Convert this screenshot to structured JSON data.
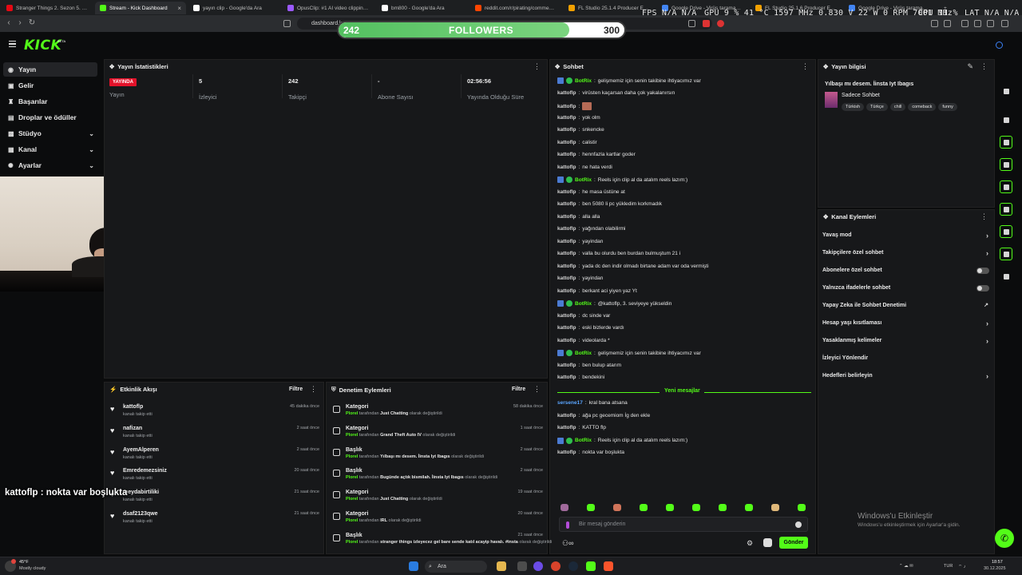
{
  "browser": {
    "tabs": [
      {
        "label": "Stranger Things 2. Sezon 5. Bölüm",
        "color": "#e50914"
      },
      {
        "label": "Stream - Kick Dashboard",
        "color": "#53fc18"
      },
      {
        "label": "yayın clip - Google'da Ara",
        "color": "#ffffff"
      },
      {
        "label": "OpusClip: #1 AI video clipping and",
        "color": "#9b59ff"
      },
      {
        "label": "bm800 - Google'da Ara",
        "color": "#ffffff"
      },
      {
        "label": "reddit.com/r/pirating/comments/",
        "color": "#ff4500"
      },
      {
        "label": "FL Studio 25.1.4 Producer Edition Y",
        "color": "#f2a100"
      },
      {
        "label": "Google Drive - Virüs taraması uya",
        "color": "#4285f4"
      },
      {
        "label": "FL Studio 25.1.6 Producer Edition",
        "color": "#f2a100"
      },
      {
        "label": "Google Drive - Virüs taraması uya",
        "color": "#4285f4"
      }
    ],
    "url": "dashboard.k"
  },
  "hud": {
    "fps": "FPS  N/A  N/A",
    "gpu": "GPU  9 %  41 °C  1597 MHz  0.830 V  22 W  0 RPM  7001 MHz",
    "cpu": "CPU  11 %",
    "lat": "LAT  N/A  N/A"
  },
  "goal": {
    "current": "242",
    "label": "FOLLOWERS",
    "target": "300",
    "progress": 0.8067
  },
  "brand": {
    "logo": "KICK",
    "beta": "BETA"
  },
  "sidebar": {
    "items": [
      {
        "label": "Yayın",
        "icon": "broadcast-icon"
      },
      {
        "label": "Gelir",
        "icon": "revenue-icon"
      },
      {
        "label": "Başarılar",
        "icon": "trophy-icon"
      },
      {
        "label": "Droplar ve ödüller",
        "icon": "gift-icon"
      },
      {
        "label": "Stüdyo",
        "icon": "studio-icon"
      },
      {
        "label": "Kanal",
        "icon": "channel-icon"
      },
      {
        "label": "Ayarlar",
        "icon": "settings-icon"
      }
    ]
  },
  "stats": {
    "title": "Yayın İstatistikleri",
    "live_badge": "YAYINDA",
    "items": [
      {
        "value": "5",
        "label": "İzleyici"
      },
      {
        "value": "242",
        "label": "Takipçi"
      },
      {
        "value": "-",
        "label": "Abone Sayısı"
      },
      {
        "value": "02:56:56",
        "label": "Yayında Olduğu Süre"
      }
    ],
    "stream_label": "Yayın"
  },
  "chat": {
    "title": "Sohbet",
    "messages": [
      {
        "user": "BotRix",
        "bot": true,
        "text": "gelişmemiz için senin takibine ihtiyacımız var"
      },
      {
        "user": "kattoflp",
        "text": "virüsten kaçarsan daha çok yakalanırsın"
      },
      {
        "user": "kattoflp",
        "text": "",
        "emote": true
      },
      {
        "user": "kattoflp",
        "text": "yok olm"
      },
      {
        "user": "kattoflp",
        "text": "snkencke"
      },
      {
        "user": "kattoflp",
        "text": "calistir"
      },
      {
        "user": "kattoflp",
        "text": "hennfazla kartlar goder"
      },
      {
        "user": "kattoflp",
        "text": "ne hata verdi"
      },
      {
        "user": "BotRix",
        "bot": true,
        "text": "Reels için clip al da atalım reels lazım:)"
      },
      {
        "user": "kattoflp",
        "text": "he masa üstüne at"
      },
      {
        "user": "kattoflp",
        "text": "ben 5080 li pc yükledim korkmadık"
      },
      {
        "user": "kattoflp",
        "text": "alla alla"
      },
      {
        "user": "kattoflp",
        "text": "yağından olabilirmi"
      },
      {
        "user": "kattoflp",
        "text": "yayindan"
      },
      {
        "user": "kattoflp",
        "text": "valla bu olurdu ben burdan bulmuştum 21 i"
      },
      {
        "user": "kattoflp",
        "text": "yada dc den indir olmadı birtane adam var oda vermişti"
      },
      {
        "user": "kattoflp",
        "text": "yayindan"
      },
      {
        "user": "kattoflp",
        "text": "berkant aci yiyen yaz Yt"
      },
      {
        "user": "BotRix",
        "bot": true,
        "text": "@kattoflp, 3. seviyeye yükseldin"
      },
      {
        "user": "kattoflp",
        "text": "dc sinde var"
      },
      {
        "user": "kattoflp",
        "text": "eski bizlerde vardı"
      },
      {
        "user": "kattoflp",
        "text": "videolarda *"
      },
      {
        "user": "BotRix",
        "bot": true,
        "text": "gelişmemiz için senin takibine ihtiyacımız var"
      },
      {
        "user": "kattoflp",
        "text": "ben bulup atarım"
      },
      {
        "user": "kattoflp",
        "text": "bendekini"
      }
    ],
    "new_messages_label": "Yeni mesajlar",
    "new_messages": [
      {
        "user": "sersene17",
        "color": "#5aa5ff",
        "text": "kral bana atsana"
      },
      {
        "user": "kattoflp",
        "text": "ağa pc gecemiom İg den ekle"
      },
      {
        "user": "kattoflp",
        "text": "KATTO flp"
      },
      {
        "user": "BotRix",
        "bot": true,
        "text": "Reels için clip al da atalım reels lazım:)"
      },
      {
        "user": "kattoflp",
        "text": "nokta var boşlukta"
      }
    ],
    "input_placeholder": "Bir mesaj gönderin",
    "send_label": "Gönder"
  },
  "stream_info": {
    "title": "Yayın bilgisi",
    "stream_title": "Yılbaşı mı desem. İinsta Iyt Ibagıs",
    "category": "Sadece Sohbet",
    "tags": [
      "Türkish",
      "Türkçe",
      "chill",
      "comeback",
      "funny"
    ]
  },
  "channel_actions": {
    "title": "Kanal Eylemleri",
    "items": [
      {
        "label": "Yavaş mod",
        "type": "arrow"
      },
      {
        "label": "Takipçilere özel sohbet",
        "type": "arrow"
      },
      {
        "label": "Abonelere özel sohbet",
        "type": "toggle"
      },
      {
        "label": "Yalnızca ifadelerle sohbet",
        "type": "toggle"
      },
      {
        "label": "Yapay Zeka ile Sohbet Denetimi",
        "type": "external"
      },
      {
        "label": "Hesap yaşı kısıtlaması",
        "type": "arrow"
      },
      {
        "label": "Yasaklanmış kelimeler",
        "type": "arrow"
      },
      {
        "label": "İzleyici Yönlendir",
        "type": "none"
      },
      {
        "label": "Hedefleri belirleyin",
        "type": "arrow"
      }
    ]
  },
  "activity": {
    "title": "Etkinlik Akışı",
    "filter": "Filtre",
    "items": [
      {
        "name": "kattoflp",
        "sub": "kanalı takip etti",
        "time": "45 dakika önce"
      },
      {
        "name": "nafizan",
        "sub": "kanalı takip etti",
        "time": "2 saat önce"
      },
      {
        "name": "AyemAlperen",
        "sub": "kanalı takip etti",
        "time": "2 saat önce"
      },
      {
        "name": "Emredemezsiniz",
        "sub": "kanalı takip etti",
        "time": "20 saat önce"
      },
      {
        "name": "meydabirtiliki",
        "sub": "kanalı takip etti",
        "time": "21 saat önce"
      },
      {
        "name": "dsaf2123qwe",
        "sub": "kanalı takip etti",
        "time": "21 saat önce"
      }
    ]
  },
  "moderation": {
    "title": "Denetim Eylemleri",
    "filter": "Filtre",
    "items": [
      {
        "type": "Kategori",
        "by": "Plorel",
        "mid": "tarafından",
        "value": "Just Chatting",
        "end": "olarak değiştirildi",
        "time": "58 dakika önce"
      },
      {
        "type": "Kategori",
        "by": "Plorel",
        "mid": "tarafından",
        "value": "Grand Theft Auto IV",
        "end": "olarak değiştirildi",
        "time": "1 saat önce"
      },
      {
        "type": "Başlık",
        "by": "Plorel",
        "mid": "tarafından",
        "value": "Yılbaşı mı desem. İinsta Iyt Ibagıs",
        "end": "olarak değiştirildi",
        "time": "2 saat önce"
      },
      {
        "type": "Başlık",
        "by": "Plorel",
        "mid": "tarafından",
        "value": "Bugünde açtık bismilah. İinsta Iyt Ibagıs",
        "end": "olarak değiştirildi",
        "time": "2 saat önce"
      },
      {
        "type": "Kategori",
        "by": "Plorel",
        "mid": "tarafından",
        "value": "Just Chatting",
        "end": "olarak değiştirildi",
        "time": "19 saat önce"
      },
      {
        "type": "Kategori",
        "by": "Plorel",
        "mid": "tarafından",
        "value": "IRL",
        "end": "olarak değiştirildi",
        "time": "20 saat önce"
      },
      {
        "type": "Başlık",
        "by": "Plorel",
        "mid": "tarafından",
        "value": "stranger things izleyecez gel bare sende katıl acayip havalı. #insta",
        "end": "olarak değiştirildi",
        "time": "21 saat önce"
      }
    ]
  },
  "overlay_chat": "kattoflp : nokta var boşlukta",
  "windows_activation": {
    "title": "Windows'u Etkinleştir",
    "sub": "Windows'u etkinleştirmek için Ayarlar'a gidin."
  },
  "taskbar": {
    "weather_temp": "45°F",
    "weather_desc": "Mostly cloudy",
    "search": "Ara",
    "lang": "TUR",
    "time": "18:57",
    "date": "30.12.2025"
  }
}
